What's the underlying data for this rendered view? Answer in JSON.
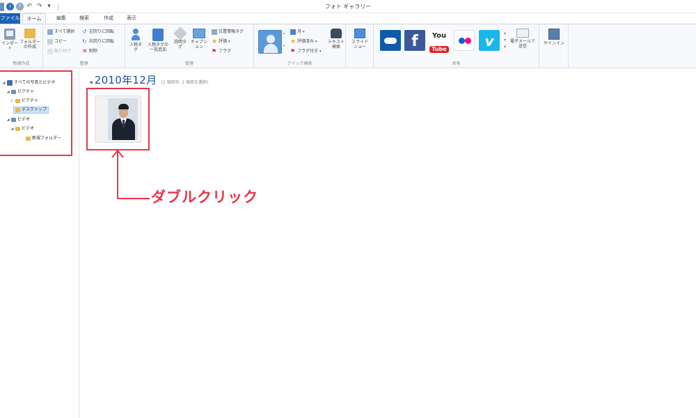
{
  "window": {
    "title": "フォト ギャラリー"
  },
  "tabs": [
    {
      "label": "ファイル"
    },
    {
      "label": "ホーム"
    },
    {
      "label": "編集"
    },
    {
      "label": "検索"
    },
    {
      "label": "作成"
    },
    {
      "label": "表示"
    }
  ],
  "ribbon": {
    "new": {
      "import": "インポート",
      "new_folder": "フォルダーの作成",
      "label": "新規作成"
    },
    "organize": {
      "select_all": "すべて選択",
      "copy": "コピー",
      "paste": "貼り付け",
      "rotate_left": "左回りに回転",
      "rotate_right": "右回りに回転",
      "delete": "削除",
      "label": "整理"
    },
    "manage": {
      "people_tag": "人物タグ",
      "batch_people_tag": "人物タグの一括追加",
      "description_tag": "説明タグ",
      "caption": "キャプション",
      "geotag": "位置情報タグ",
      "rating": "評価",
      "flag": "フラグ",
      "label": "管理"
    },
    "quick_find": {
      "month": "月",
      "rating": "評価済み",
      "flagged": "フラグ付き",
      "text_search": "テキスト検索",
      "label": "クイック検索"
    },
    "slideshow": {
      "label": "スライドショー"
    },
    "share": {
      "email": "電子メールで送信",
      "label": "共有"
    },
    "sign_in": "サインイン"
  },
  "nav": {
    "items": [
      {
        "label": "すべての写真とビデオ"
      },
      {
        "label": "ピクチャ"
      },
      {
        "label": "ピクチャ"
      },
      {
        "label": "デスクトップ"
      },
      {
        "label": "ビデオ"
      },
      {
        "label": "ビデオ"
      },
      {
        "label": "新規フォルダー"
      }
    ]
  },
  "content": {
    "group_title": "2010年12月",
    "group_meta": "(1 項目中, 1 項目を選択)"
  },
  "annotation": {
    "callout": "ダブルクリック"
  },
  "colors": {
    "accent": "#1c62b8",
    "annotation": "#e8344a",
    "date_header": "#1f4e99"
  },
  "icons": {
    "share_services": [
      "onedrive-icon",
      "facebook-icon",
      "youtube-icon",
      "flickr-icon",
      "vimeo-icon"
    ]
  }
}
